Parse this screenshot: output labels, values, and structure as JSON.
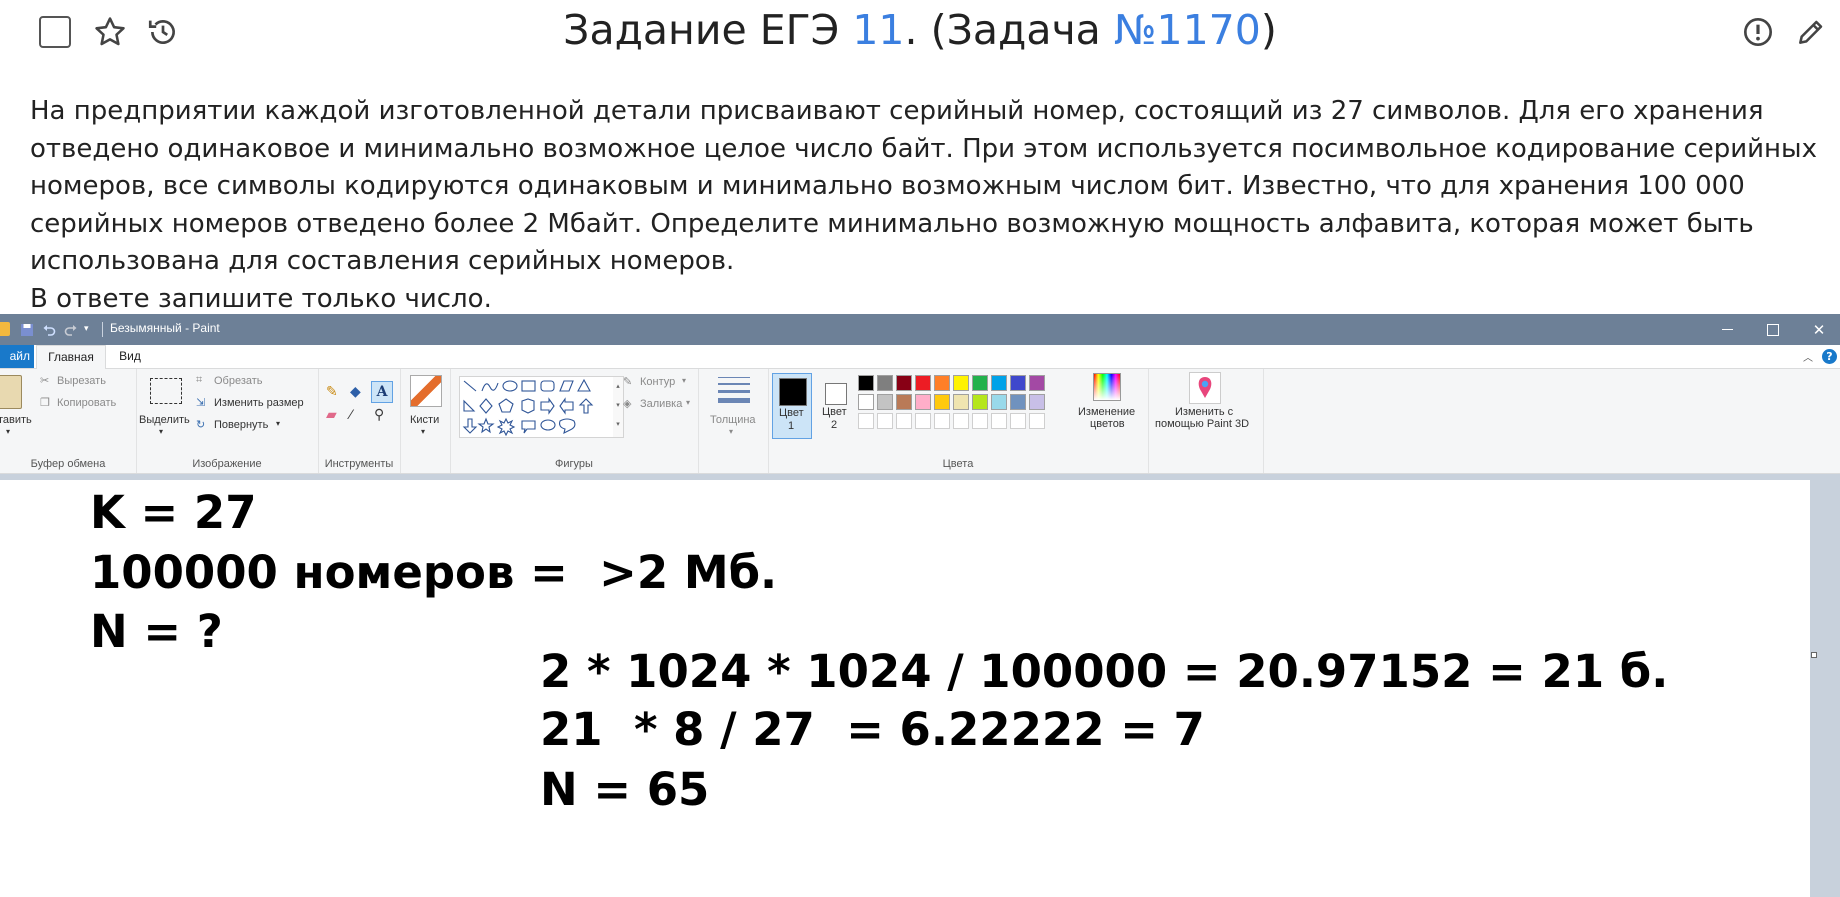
{
  "header": {
    "title_prefix": "Задание ЕГЭ ",
    "task_number": "11",
    "title_middle": ". (Задача ",
    "task_id": "№1170",
    "title_suffix": ")"
  },
  "task": {
    "paragraph": "На предприятии каждой изготовленной детали присваивают серийный номер, состоящий из 27 символов. Для его хранения отведено одинаковое и минимально возможное целое число байт. При этом используется посимвольное кодирование серийных номеров, все символы кодируются одинаковым и минимально возможным числом бит. Известно, что для хранения 100 000 серийных номеров отведено более 2 Мбайт. Определите минимально возможную мощность алфавита, которая может быть использована для составления серийных номеров.",
    "instruction": "В ответе запишите только число."
  },
  "paint": {
    "window_title": "Безымянный - Paint",
    "tabs": {
      "file": "айл",
      "home": "Главная",
      "view": "Вид"
    },
    "clipboard": {
      "paste": "тавить",
      "cut": "Вырезать",
      "copy": "Копировать",
      "label": "Буфер обмена"
    },
    "image": {
      "select": "Выделить",
      "crop": "Обрезать",
      "resize": "Изменить размер",
      "rotate": "Повернуть",
      "label": "Изображение"
    },
    "tools": {
      "label": "Инструменты"
    },
    "brushes": {
      "label": "Кисти"
    },
    "shapes": {
      "outline": "Контур",
      "fill": "Заливка",
      "label": "Фигуры"
    },
    "size": {
      "label": "Толщина"
    },
    "colors": {
      "color1_line1": "Цвет",
      "color1_line2": "1",
      "color2_line1": "Цвет",
      "color2_line2": "2",
      "edit_line1": "Изменение",
      "edit_line2": "цветов",
      "label": "Цвета",
      "row1": [
        "#000000",
        "#7f7f7f",
        "#880015",
        "#ed1c24",
        "#ff7f27",
        "#fff200",
        "#22b14c",
        "#00a2e8",
        "#3f48cc",
        "#a349a4"
      ],
      "row2": [
        "#ffffff",
        "#c3c3c3",
        "#b97a57",
        "#ffaec9",
        "#ffc90e",
        "#efe4b0",
        "#b5e61d",
        "#99d9ea",
        "#7092be",
        "#c8bfe7"
      ]
    },
    "paint3d": {
      "line1": "Изменить с",
      "line2": "помощью Paint 3D"
    }
  },
  "canvas_lines": [
    "K = 27",
    "100000 номеров =  >2 Мб.",
    "N = ?",
    "2 * 1024 * 1024 / 100000 = 20.97152 = 21 б.",
    "21  * 8 / 27  = 6.22222 = 7",
    "N = 65"
  ]
}
